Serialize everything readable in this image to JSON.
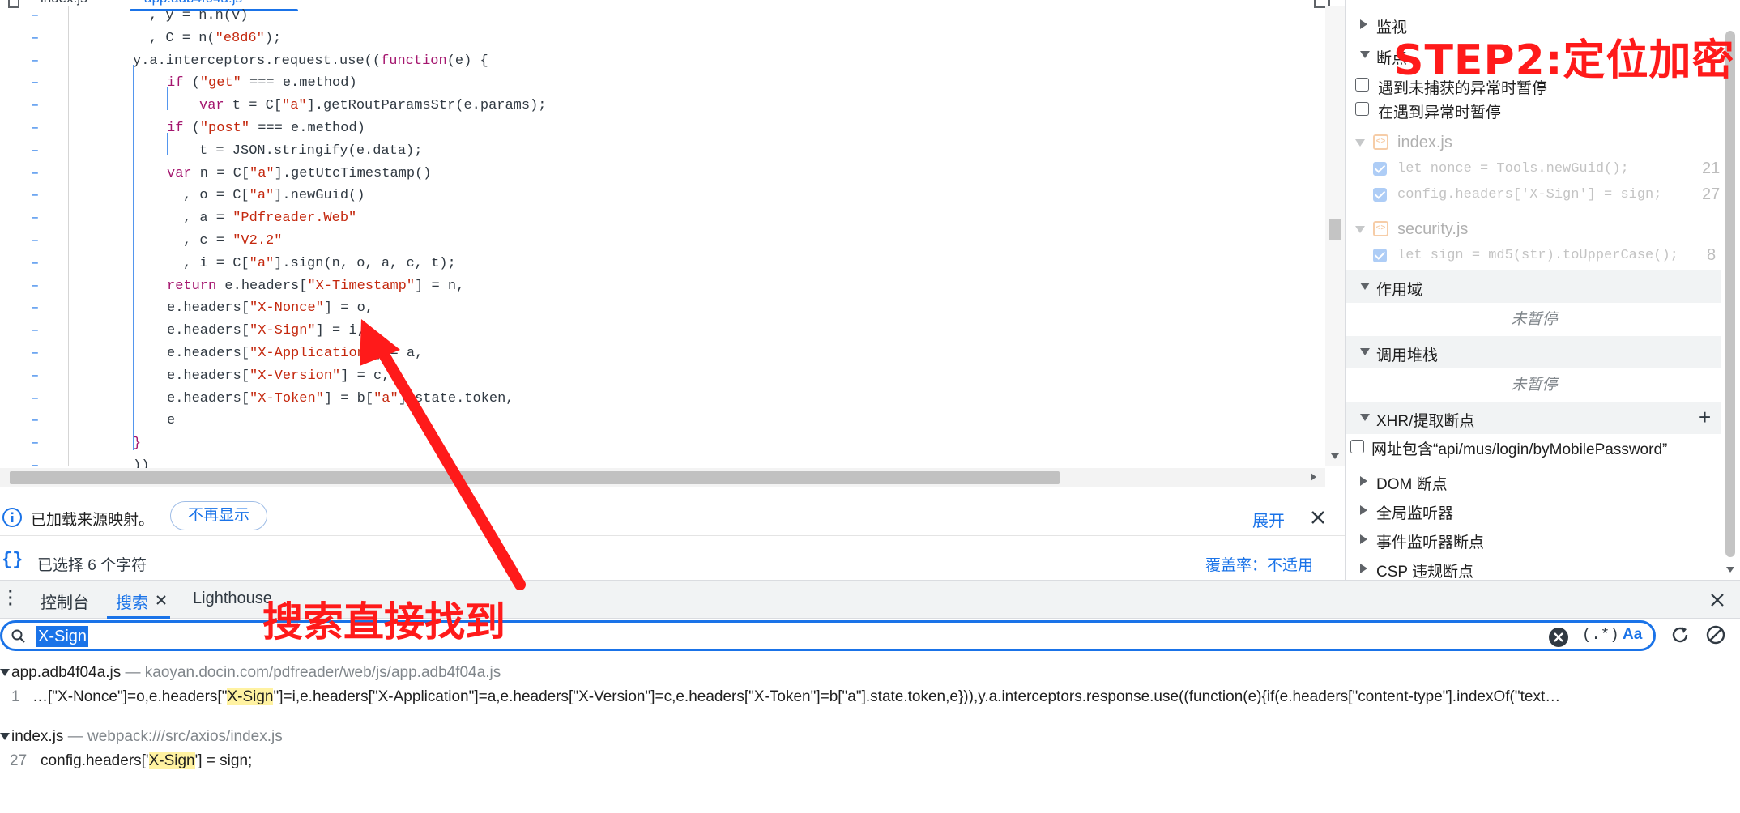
{
  "editor": {
    "tab_partial_1": "index.js",
    "tab_partial_2": "app.adb4f04a.js",
    "lines": [
      {
        "indent": 184,
        "tokens": [
          {
            "t": ", y = n.n(v)",
            "c": ""
          }
        ]
      },
      {
        "indent": 184,
        "tokens": [
          {
            "t": ", C = n(",
            "c": ""
          },
          {
            "t": "\"e8d6\"",
            "c": "str"
          },
          {
            "t": ");",
            "c": ""
          }
        ]
      },
      {
        "indent": 164,
        "tokens": [
          {
            "t": "y.a.interceptors.request.use((",
            "c": ""
          },
          {
            "t": "function",
            "c": "kw"
          },
          {
            "t": "(e) {",
            "c": ""
          }
        ]
      },
      {
        "indent": 206,
        "tokens": [
          {
            "t": "if",
            "c": "kw"
          },
          {
            "t": " (",
            "c": ""
          },
          {
            "t": "\"get\"",
            "c": "str"
          },
          {
            "t": " === e.method)",
            "c": ""
          }
        ]
      },
      {
        "indent": 246,
        "tokens": [
          {
            "t": "var",
            "c": "kw"
          },
          {
            "t": " t = C[",
            "c": ""
          },
          {
            "t": "\"a\"",
            "c": "str"
          },
          {
            "t": "].getRoutParamsStr(e.params);",
            "c": ""
          }
        ]
      },
      {
        "indent": 206,
        "tokens": [
          {
            "t": "if",
            "c": "kw"
          },
          {
            "t": " (",
            "c": ""
          },
          {
            "t": "\"post\"",
            "c": "str"
          },
          {
            "t": " === e.method)",
            "c": ""
          }
        ]
      },
      {
        "indent": 246,
        "tokens": [
          {
            "t": "t = JSON.stringify(e.data);",
            "c": ""
          }
        ]
      },
      {
        "indent": 206,
        "tokens": [
          {
            "t": "var",
            "c": "kw"
          },
          {
            "t": " n = C[",
            "c": ""
          },
          {
            "t": "\"a\"",
            "c": "str"
          },
          {
            "t": "].getUtcTimestamp()",
            "c": ""
          }
        ]
      },
      {
        "indent": 226,
        "tokens": [
          {
            "t": ", o = C[",
            "c": ""
          },
          {
            "t": "\"a\"",
            "c": "str"
          },
          {
            "t": "].newGuid()",
            "c": ""
          }
        ]
      },
      {
        "indent": 226,
        "tokens": [
          {
            "t": ", a = ",
            "c": ""
          },
          {
            "t": "\"Pdfreader.Web\"",
            "c": "str"
          }
        ]
      },
      {
        "indent": 226,
        "tokens": [
          {
            "t": ", c = ",
            "c": ""
          },
          {
            "t": "\"V2.2\"",
            "c": "str"
          }
        ]
      },
      {
        "indent": 226,
        "tokens": [
          {
            "t": ", i = C[",
            "c": ""
          },
          {
            "t": "\"a\"",
            "c": "str"
          },
          {
            "t": "].sign(n, o, a, c, t);",
            "c": ""
          }
        ]
      },
      {
        "indent": 206,
        "tokens": [
          {
            "t": "return",
            "c": "kw"
          },
          {
            "t": " e.headers[",
            "c": ""
          },
          {
            "t": "\"X-Timestamp\"",
            "c": "str"
          },
          {
            "t": "] = n,",
            "c": ""
          }
        ]
      },
      {
        "indent": 206,
        "tokens": [
          {
            "t": "e.headers[",
            "c": ""
          },
          {
            "t": "\"X-Nonce\"",
            "c": "str"
          },
          {
            "t": "] = o,",
            "c": ""
          }
        ]
      },
      {
        "indent": 206,
        "tokens": [
          {
            "t": "e.headers[",
            "c": ""
          },
          {
            "t": "\"X-Sign\"",
            "c": "str"
          },
          {
            "t": "] = i,",
            "c": ""
          }
        ]
      },
      {
        "indent": 206,
        "tokens": [
          {
            "t": "e.headers[",
            "c": ""
          },
          {
            "t": "\"X-Application\"",
            "c": "str"
          },
          {
            "t": "] = a,",
            "c": ""
          }
        ]
      },
      {
        "indent": 206,
        "tokens": [
          {
            "t": "e.headers[",
            "c": ""
          },
          {
            "t": "\"X-Version\"",
            "c": "str"
          },
          {
            "t": "] = c,",
            "c": ""
          }
        ]
      },
      {
        "indent": 206,
        "tokens": [
          {
            "t": "e.headers[",
            "c": ""
          },
          {
            "t": "\"X-Token\"",
            "c": "str"
          },
          {
            "t": "] = b[",
            "c": ""
          },
          {
            "t": "\"a\"",
            "c": "str"
          },
          {
            "t": "].state.token,",
            "c": ""
          }
        ]
      },
      {
        "indent": 206,
        "tokens": [
          {
            "t": "e",
            "c": ""
          }
        ]
      },
      {
        "indent": 164,
        "tokens": [
          {
            "t": "}",
            "c": "kw"
          }
        ]
      },
      {
        "indent": 164,
        "tokens": [
          {
            "t": "))",
            "c": ""
          }
        ]
      }
    ],
    "gutter_mark": "–"
  },
  "infobar": {
    "message": "已加载来源映射。",
    "dismiss_label": "不再显示",
    "expand_label": "展开"
  },
  "statusbar": {
    "selection": "已选择 6 个字符",
    "coverage": "覆盖率：不适用"
  },
  "sidebar": {
    "watch": "监视",
    "breakpoints": "断点",
    "pause_uncaught": "遇到未捕获的异常时暂停",
    "pause_caught": "在遇到异常时暂停",
    "files": [
      {
        "name": "index.js",
        "bps": [
          {
            "code": "let nonce = Tools.newGuid();",
            "line": "21"
          },
          {
            "code": "config.headers['X-Sign'] = sign;",
            "line": "27"
          }
        ]
      },
      {
        "name": "security.js",
        "bps": [
          {
            "code": "let sign = md5(str).toUpperCase();",
            "line": "8"
          }
        ]
      }
    ],
    "scope": "作用域",
    "not_paused_1": "未暂停",
    "call_stack": "调用堆栈",
    "not_paused_2": "未暂停",
    "xhr_bp": "XHR/提取断点",
    "xhr_bp_add": "+",
    "xhr_bp_item": "网址包含“api/mus/login/byMobilePassword”",
    "dom_bp": "DOM 断点",
    "global_listeners": "全局监听器",
    "event_listener_bp": "事件监听器断点",
    "csp_bp": "CSP 违规断点"
  },
  "drawer": {
    "console_tab": "控制台",
    "search_tab": "搜索",
    "lighthouse_tab": "Lighthouse",
    "close": "×"
  },
  "search": {
    "query": "X-Sign",
    "regex_label": "(.*)",
    "case_label": "Aa"
  },
  "results": {
    "files": [
      {
        "name": "app.adb4f04a.js",
        "sep": " — ",
        "path": "kaoyan.docin.com/pdfreader/web/js/app.adb4f04a.js",
        "line": "1",
        "pre": "…[\"X-Nonce\"]=o,e.headers[\"",
        "match": "X-Sign",
        "post": "\"]=i,e.headers[\"X-Application\"]=a,e.headers[\"X-Version\"]=c,e.headers[\"X-Token\"]=b[\"a\"].state.token,e})),y.a.interceptors.response.use((function(e){if(e.headers[\"content-type\"].indexOf(\"text…"
      },
      {
        "name": "index.js",
        "sep": " — ",
        "path": "webpack:///src/axios/index.js",
        "line": "27",
        "pre": "config.headers['",
        "match": "X-Sign",
        "post": "'] = sign;"
      }
    ]
  },
  "annotations": {
    "step2": "STEP2:定位加密",
    "search_found": "搜索直接找到",
    "color": "#ff1a1a"
  },
  "colors": {
    "accent": "#1a73e8",
    "keyword": "#a4156e",
    "string": "#c4280e",
    "match_highlight": "#fff2a1"
  }
}
